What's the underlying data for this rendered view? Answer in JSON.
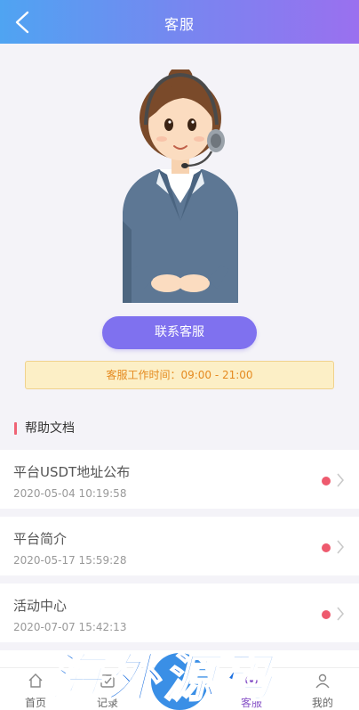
{
  "header": {
    "title": "客服",
    "back_icon": "chevron-left-icon"
  },
  "contact": {
    "button_label": "联系客服",
    "hours_text": "客服工作时间：09:00 - 21:00"
  },
  "help": {
    "section_title": "帮助文档",
    "items": [
      {
        "title": "平台USDT地址公布",
        "date": "2020-05-04 10:19:58"
      },
      {
        "title": "平台简介",
        "date": "2020-05-17 15:59:28"
      },
      {
        "title": "活动中心",
        "date": "2020-07-07 15:42:13"
      }
    ]
  },
  "tabbar": {
    "tabs": [
      {
        "label": "首页",
        "icon": "home-icon"
      },
      {
        "label": "记录",
        "icon": "record-icon"
      },
      {
        "label": "",
        "icon": "center-icon"
      },
      {
        "label": "客服",
        "icon": "service-icon"
      },
      {
        "label": "我的",
        "icon": "user-icon"
      }
    ],
    "active_index": 3
  },
  "watermark": {
    "text": "海外源码"
  },
  "colors": {
    "header_start": "#4fa4f2",
    "header_end": "#9a70ef",
    "button": "#7f71ef",
    "hours_bg": "#fcefc6",
    "hours_text": "#e58a1f",
    "dot": "#ee5a6e",
    "active_tab": "#8a57c8"
  }
}
